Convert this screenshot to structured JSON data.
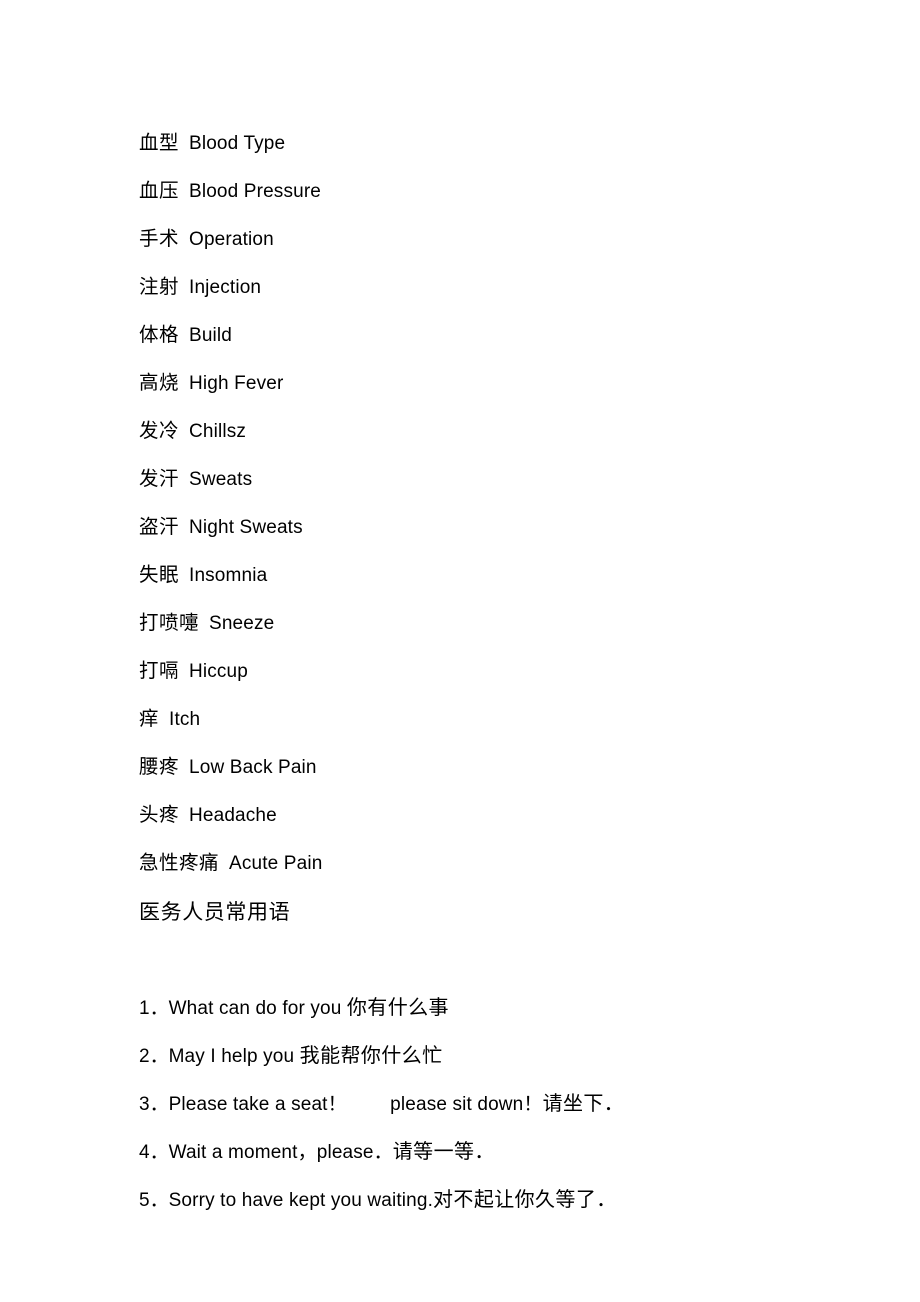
{
  "document": {
    "background_color": "#ffffff",
    "text_color": "#000000"
  },
  "glossary": {
    "items": [
      {
        "cn": "血型",
        "en": "Blood Type"
      },
      {
        "cn": "血压",
        "en": "Blood Pressure"
      },
      {
        "cn": "手术",
        "en": "Operation"
      },
      {
        "cn": "注射",
        "en": "Injection"
      },
      {
        "cn": "体格",
        "en": "Build"
      },
      {
        "cn": "高烧",
        "en": "High Fever"
      },
      {
        "cn": "发冷",
        "en": "Chillsz"
      },
      {
        "cn": "发汗",
        "en": "Sweats"
      },
      {
        "cn": "盗汗",
        "en": "Night Sweats"
      },
      {
        "cn": "失眠",
        "en": "Insomnia"
      },
      {
        "cn": "打喷嚏",
        "en": "Sneeze"
      },
      {
        "cn": "打嗝",
        "en": "Hiccup"
      },
      {
        "cn": "痒",
        "en": "Itch"
      },
      {
        "cn": "腰疼",
        "en": "Low Back Pain"
      },
      {
        "cn": "头疼",
        "en": "Headache"
      },
      {
        "cn": "急性疼痛",
        "en": "Acute Pain"
      }
    ]
  },
  "phrases_section": {
    "heading": "医务人员常用语",
    "items": [
      {
        "number": "1．",
        "english": "What can do for you ",
        "chinese": "你有什么事"
      },
      {
        "number": "2．",
        "english": "May I help you ",
        "chinese": "我能帮你什么忙"
      },
      {
        "number": "3．",
        "english": "Please take a seat！        please sit down！",
        "chinese": "请坐下．"
      },
      {
        "number": "4．",
        "english": "Wait a moment，please．",
        "chinese": "请等一等．"
      },
      {
        "number": "5．",
        "english": "Sorry to have kept you waiting.",
        "chinese": "对不起让你久等了．"
      }
    ]
  }
}
